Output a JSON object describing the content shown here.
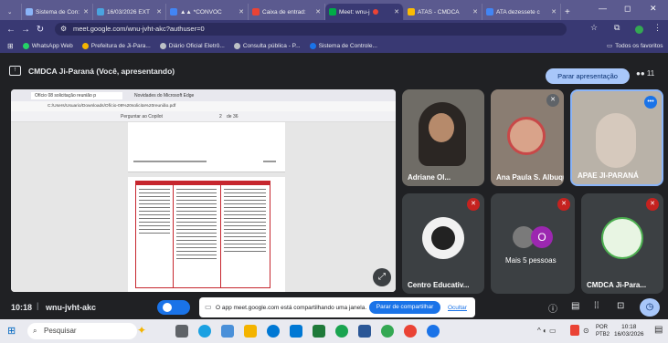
{
  "tabs": [
    {
      "label": "Sistema de Con:",
      "color": "#8ab4f8"
    },
    {
      "label": "16/03/2026 EXT",
      "color": "#4aa3df"
    },
    {
      "label": "▲▲ *CONVOC",
      "color": "#4285f4"
    },
    {
      "label": "Caixa de entrad:",
      "color": "#ea4335"
    },
    {
      "label": "Meet: wnu-j",
      "color": "#00ac47"
    },
    {
      "label": "ATAS - CMDCA",
      "color": "#fbbc04"
    },
    {
      "label": "ATA dezessete c",
      "color": "#4285f4"
    }
  ],
  "url": "meet.google.com/wnu-jvht-akc?authuser=0",
  "bookmarks": [
    "WhatsApp Web",
    "Prefeitura de Ji-Para...",
    "Diário Oficial Eletrô...",
    "Consulta pública - P...",
    "Sistema de Controle..."
  ],
  "all_bookmarks": "Todos os favoritos",
  "presenter": "CMDCA Ji-Paraná (Você, apresentando)",
  "stop_presenting": "Parar apresentação",
  "participant_count": "11",
  "inner_browser": {
    "tab1": "Ofício 08 solicitação reunião p",
    "tab2": "Novidades do Microsoft Edge",
    "path": "C:/Users/Usuario/Downloads/Ofício-08%20solicita%20reunião.pdf",
    "copilot": "Perguntar ao Copilot",
    "page": "2",
    "of_pages": "de 36"
  },
  "tiles": [
    {
      "name": "Adriane Ol...",
      "bg": "#6f6c66"
    },
    {
      "name": "Ana Paula S. Albuqu...",
      "bg": "#8a7d72"
    },
    {
      "name": "APAE JI-PARANÁ",
      "bg": "#b9b2a8"
    },
    {
      "name": "Centro Educativ...",
      "bg": "#3c4043"
    },
    {
      "name": "Mais 5 pessoas",
      "bg": "#3c4043"
    },
    {
      "name": "CMDCA Ji-Para...",
      "bg": "#3c4043"
    }
  ],
  "more_people_avatar": "O",
  "clock": "10:18",
  "meeting_code": "wnu-jvht-akc",
  "share_notice": "O app meet.google.com está compartilhando uma janela.",
  "stop_sharing": "Parar de compartilhar",
  "hide": "Ocultar",
  "taskbar": {
    "search": "Pesquisar",
    "lang": "POR",
    "kbd": "PTB2",
    "time": "10:18",
    "date": "16/03/2026"
  }
}
